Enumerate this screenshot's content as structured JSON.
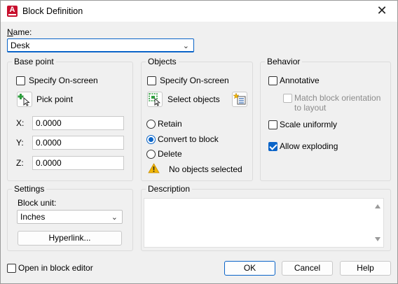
{
  "window": {
    "title": "Block Definition",
    "close_glyph": "✕",
    "app_icon_letter": "A"
  },
  "name": {
    "label": "Name:",
    "value": "Desk"
  },
  "base_point": {
    "title": "Base point",
    "specify_onscreen": {
      "label": "Specify On-screen",
      "checked": false
    },
    "pick_point_label": "Pick point",
    "x": {
      "label": "X:",
      "value": "0.0000"
    },
    "y": {
      "label": "Y:",
      "value": "0.0000"
    },
    "z": {
      "label": "Z:",
      "value": "0.0000"
    }
  },
  "objects": {
    "title": "Objects",
    "specify_onscreen": {
      "label": "Specify On-screen",
      "checked": false
    },
    "select_objects_label": "Select objects",
    "retain_label": "Retain",
    "convert_label": "Convert to block",
    "delete_label": "Delete",
    "selected_option": "Convert to block",
    "status": "No objects selected"
  },
  "behavior": {
    "title": "Behavior",
    "annotative": {
      "label": "Annotative",
      "checked": false
    },
    "match_orientation": {
      "line1": "Match block orientation",
      "line2": "to layout",
      "checked": false,
      "enabled": false
    },
    "scale_uniformly": {
      "label": "Scale uniformly",
      "checked": false
    },
    "allow_exploding": {
      "label": "Allow exploding",
      "checked": true
    }
  },
  "settings": {
    "title": "Settings",
    "block_unit_label": "Block unit:",
    "block_unit_value": "Inches",
    "hyperlink_label": "Hyperlink..."
  },
  "description": {
    "title": "Description",
    "value": ""
  },
  "footer": {
    "open_in_editor": {
      "label": "Open in block editor",
      "checked": false
    },
    "ok_label": "OK",
    "cancel_label": "Cancel",
    "help_label": "Help"
  },
  "colors": {
    "accent": "#0a64c8",
    "brand": "#c8102e",
    "warning": "#f2b705"
  }
}
